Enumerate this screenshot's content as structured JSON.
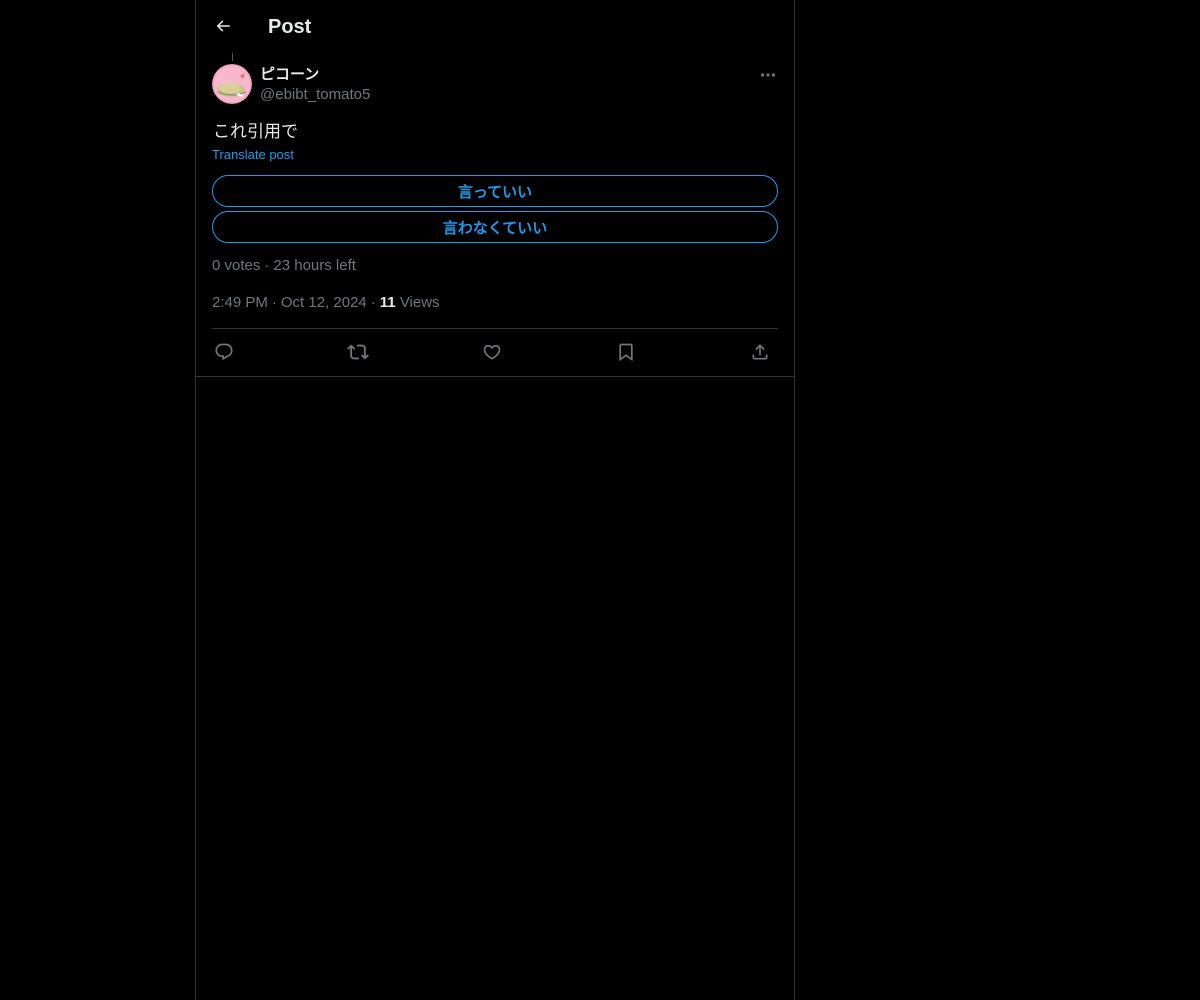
{
  "header": {
    "title": "Post",
    "back_icon": "arrow-left-icon"
  },
  "author": {
    "display_name": "ピコーン",
    "handle": "@ebibt_tomato5",
    "avatar_icon": "avatar-image"
  },
  "post": {
    "text": "これ引用で",
    "translate_label": "Translate post"
  },
  "poll": {
    "options": [
      {
        "label": "言っていい"
      },
      {
        "label": "言わなくていい"
      }
    ],
    "votes_text": "0 votes",
    "time_left": "23 hours left"
  },
  "meta": {
    "time": "2:49 PM",
    "date": "Oct 12, 2024",
    "views_count": "11",
    "views_label": "Views",
    "separator": "·"
  },
  "actions": {
    "reply_icon": "reply-icon",
    "repost_icon": "repost-icon",
    "like_icon": "heart-icon",
    "bookmark_icon": "bookmark-icon",
    "share_icon": "share-icon"
  },
  "colors": {
    "background": "#000000",
    "text_primary": "#e7e9ea",
    "text_secondary": "#71767b",
    "accent": "#1d9bf0",
    "border": "#2f3336"
  }
}
